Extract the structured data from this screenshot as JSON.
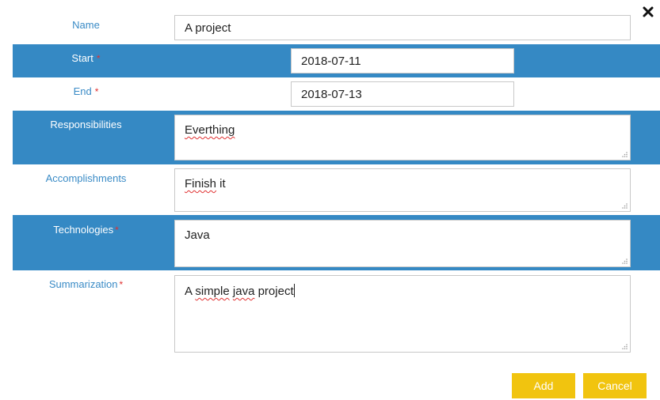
{
  "dialog": {
    "close_icon": "close-x-icon"
  },
  "fields": {
    "name": {
      "label": "Name",
      "value": "A project"
    },
    "start": {
      "label": "Start",
      "required_mark": "*",
      "value": "2018-07-11"
    },
    "end": {
      "label": "End",
      "required_mark": "*",
      "value": "2018-07-13"
    },
    "responsibilities": {
      "label": "Responsibilities",
      "value": "Everthing"
    },
    "accomplishments": {
      "label": "Accomplishments",
      "value_word1": "Finish",
      "value_rest": " it"
    },
    "technologies": {
      "label": "Technologies",
      "required_mark": "*",
      "value": "Java"
    },
    "summarization": {
      "label": "Summarization",
      "required_mark": "*",
      "value_a": "A ",
      "value_simple": "simple",
      "value_mid": " ",
      "value_java": "java",
      "value_end": " project"
    }
  },
  "buttons": {
    "add_label": "Add",
    "cancel_label": "Cancel"
  },
  "colors": {
    "band": "#3589c4",
    "label_blue": "#3a8bc6",
    "button_yellow": "#f1c40f",
    "required_red": "#e03131"
  }
}
